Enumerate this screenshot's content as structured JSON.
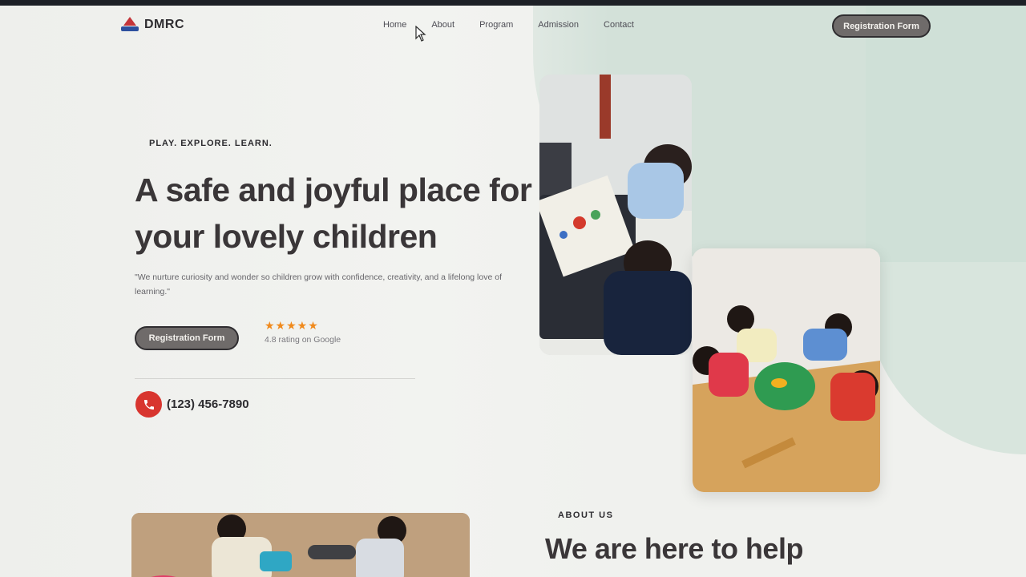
{
  "brand": {
    "name": "DMRC"
  },
  "nav": {
    "items": [
      "Home",
      "About",
      "Program",
      "Admission",
      "Contact"
    ],
    "cta": "Registration Form"
  },
  "hero": {
    "eyebrow": "PLAY. EXPLORE. LEARN.",
    "title": "A safe and joyful place for your lovely children",
    "quote": "\"We nurture curiosity and wonder so children grow with confidence, creativity, and a lifelong love of learning.\"",
    "cta": "Registration Form",
    "stars": "★★★★★",
    "rating_text": "4.8 rating on Google",
    "phone": "(123) 456-7890"
  },
  "about": {
    "eyebrow": "ABOUT US",
    "title": "We are here to help"
  },
  "icons": {
    "logo": "logo-icon",
    "phone": "phone-icon",
    "cursor": "mouse-cursor-icon"
  },
  "colors": {
    "accent_red": "#d8352f",
    "button": "#6f6b6a",
    "star": "#f08a1c",
    "blob": "#c9dbd1"
  }
}
